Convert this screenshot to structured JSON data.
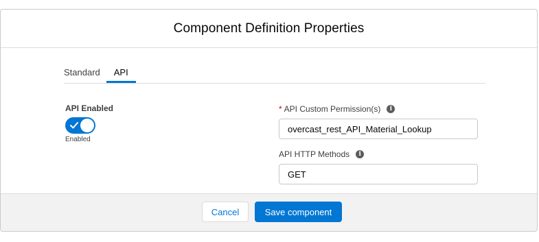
{
  "modal": {
    "title": "Component Definition Properties"
  },
  "tabs": [
    {
      "label": "Standard",
      "active": false
    },
    {
      "label": "API",
      "active": true
    }
  ],
  "api_enabled": {
    "label": "API Enabled",
    "checked": true,
    "status_text": "Enabled"
  },
  "custom_permission": {
    "required_mark": "*",
    "label": "API Custom Permission(s)",
    "value": "overcast_rest_API_Material_Lookup"
  },
  "http_methods": {
    "label": "API HTTP Methods",
    "value": "GET"
  },
  "footer": {
    "cancel_label": "Cancel",
    "save_label": "Save component"
  },
  "colors": {
    "brand": "#0176d3",
    "required": "#ba0517",
    "footer_bg": "#f3f2f2"
  },
  "icons": {
    "info": "info-icon",
    "check": "check-icon"
  }
}
